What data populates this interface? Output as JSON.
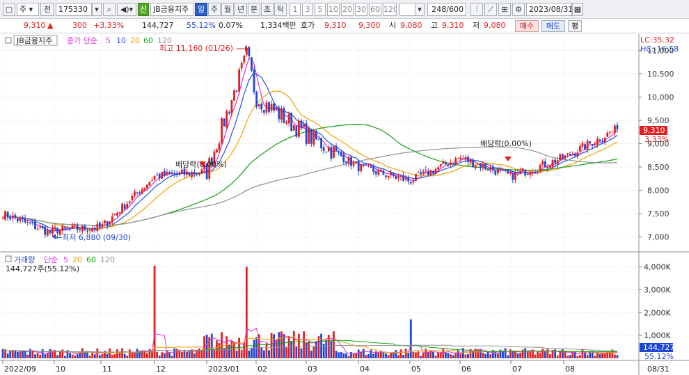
{
  "toolbar": {
    "market_type": "주",
    "market_prefix": "전",
    "stock_code": "175330",
    "credit_badge": "신",
    "stock_name": "JB금융지주",
    "periods": [
      "일",
      "주",
      "월",
      "년",
      "분",
      "초",
      "틱"
    ],
    "active_period": "일",
    "ticks": [
      "1",
      "3",
      "5",
      "10",
      "20",
      "30",
      "60",
      "120"
    ],
    "count": "248/600",
    "date": "2023/08/31"
  },
  "quote": {
    "price": "9,310",
    "change_arrow": "▲",
    "change": "300",
    "change_pct": "+3.33%",
    "volume": "144,727",
    "vol_ratio": "55.12%",
    "turnover": "0.07%",
    "trade_value": "1,334백만",
    "bid_label": "호가",
    "ask_price": "9,310",
    "bid_price": "9,300",
    "open_label": "시",
    "open": "9,080",
    "high_label": "고",
    "high": "9,310",
    "low_label": "저",
    "low": "9,080",
    "buy_label": "매수",
    "sell_label": "매도",
    "eval_label": "평"
  },
  "price_panel": {
    "name_label": "JB금융지주",
    "ma_title": "종가 단순",
    "ma_periods": [
      "5",
      "10",
      "20",
      "60",
      "120"
    ],
    "lc": "LC:35.32",
    "hc": "HC:-16.58",
    "high_annot": "최고 11,160 (01/26)",
    "low_annot": "←최저 6,880 (09/30)",
    "div1": "배당락(0.00%)",
    "div2": "배당락(0.00%)",
    "last_price_tag": "9,310",
    "last_pct_tag": "3.33%",
    "y_ticks": [
      "11,000",
      "10,500",
      "10,000",
      "9,500",
      "9,000",
      "8,500",
      "8,000",
      "7,500",
      "7,000"
    ]
  },
  "volume_panel": {
    "title": "거래량",
    "ma_title": "단순",
    "ma_periods": [
      "5",
      "20",
      "60",
      "120"
    ],
    "current": "144,727주(55.12%)",
    "y_ticks": [
      "4,000K",
      "3,000K",
      "2,000K",
      "1,000K"
    ],
    "last_tag": "144,727",
    "last_pct_tag": "55.12%"
  },
  "x_axis": {
    "labels": [
      "2022/09",
      "10",
      "11",
      "12",
      "2023/01",
      "02",
      "03",
      "04",
      "05",
      "06",
      "07",
      "08"
    ],
    "right_label": "08/31"
  },
  "colors": {
    "up": "#e02020",
    "down": "#1f47d1",
    "ma5": "#e030e0",
    "ma10": "#2050e0",
    "ma20": "#f0a000",
    "ma60": "#10a010",
    "ma120": "#909090"
  },
  "chart_data": {
    "type": "candlestick",
    "title": "JB금융지주",
    "date_range": [
      "2022/09",
      "2023/08/31"
    ],
    "price_ylim": [
      6800,
      11200
    ],
    "price_anchors": [
      {
        "date": "2022/09",
        "close": 7500
      },
      {
        "date": "09/30",
        "low": 6880
      },
      {
        "date": "10",
        "close": 7150
      },
      {
        "date": "11",
        "close": 7200
      },
      {
        "date": "12",
        "close": 8300
      },
      {
        "date": "2023/01",
        "close": 8400
      },
      {
        "date": "01/26",
        "high": 11160
      },
      {
        "date": "02",
        "close": 10000
      },
      {
        "date": "03",
        "close": 9200
      },
      {
        "date": "04",
        "close": 8500
      },
      {
        "date": "05",
        "close": 8200
      },
      {
        "date": "06",
        "close": 8700
      },
      {
        "date": "07",
        "close": 8300
      },
      {
        "date": "08",
        "close": 8700
      },
      {
        "date": "08/31",
        "close": 9310
      }
    ],
    "volume_ylim": [
      0,
      4200
    ],
    "volume_unit": "K",
    "volume_peaks": [
      {
        "date": "12",
        "value": 4050
      },
      {
        "date": "01/26",
        "value": 4000
      },
      {
        "date": "05",
        "value": 1700
      },
      {
        "date": "08/31",
        "value": 144.727
      }
    ]
  }
}
